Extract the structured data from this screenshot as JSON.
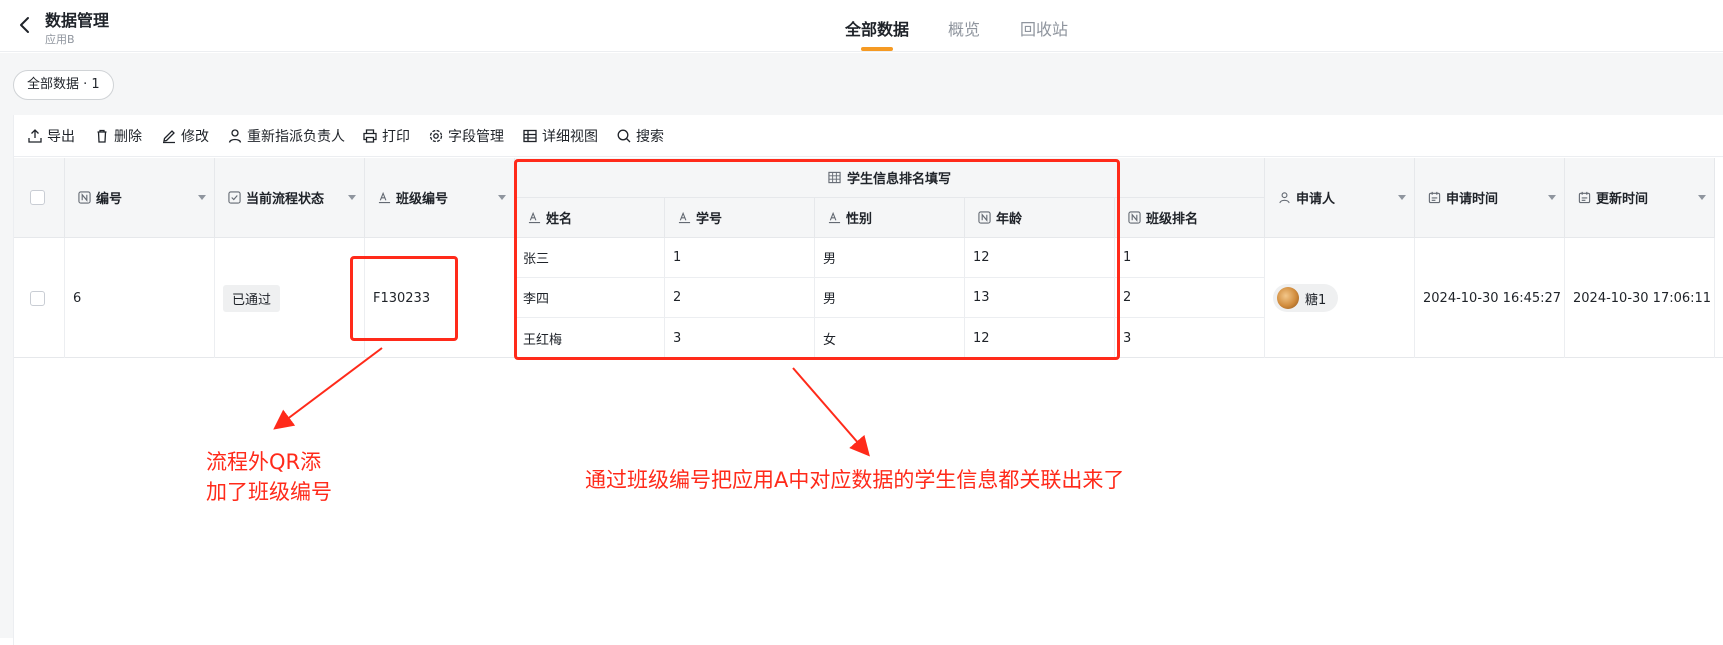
{
  "header": {
    "title": "数据管理",
    "subtitle": "应用B",
    "tabs": [
      {
        "label": "全部数据",
        "active": true
      },
      {
        "label": "概览",
        "active": false
      },
      {
        "label": "回收站",
        "active": false
      }
    ]
  },
  "filter_chip": "全部数据 · 1",
  "toolbar": {
    "export": "导出",
    "delete": "删除",
    "edit": "修改",
    "reassign": "重新指派负责人",
    "print": "打印",
    "field_manage": "字段管理",
    "detail_view": "详细视图",
    "search": "搜索"
  },
  "columns": {
    "id": "编号",
    "status": "当前流程状态",
    "class_no": "班级编号",
    "group": "学生信息排名填写",
    "name": "姓名",
    "student_no": "学号",
    "gender": "性别",
    "age": "年龄",
    "rank": "班级排名",
    "applicant": "申请人",
    "apply_time": "申请时间",
    "update_time": "更新时间"
  },
  "record": {
    "id": "6",
    "status": "已通过",
    "class_no": "F130233",
    "applicant": "糖1",
    "apply_time": "2024-10-30 16:45:27",
    "update_time": "2024-10-30 17:06:11"
  },
  "students": [
    {
      "name": "张三",
      "student_no": "1",
      "gender": "男",
      "age": "12",
      "rank": "1"
    },
    {
      "name": "李四",
      "student_no": "2",
      "gender": "男",
      "age": "13",
      "rank": "2"
    },
    {
      "name": "王红梅",
      "student_no": "3",
      "gender": "女",
      "age": "12",
      "rank": "3"
    }
  ],
  "annotations": {
    "left_note_line1": "流程外QR添",
    "left_note_line2": "加了班级编号",
    "right_note": "通过班级编号把应用A中对应数据的学生信息都关联出来了"
  },
  "colors": {
    "accent": "#f59a23",
    "annotation": "#ff2a1a"
  }
}
